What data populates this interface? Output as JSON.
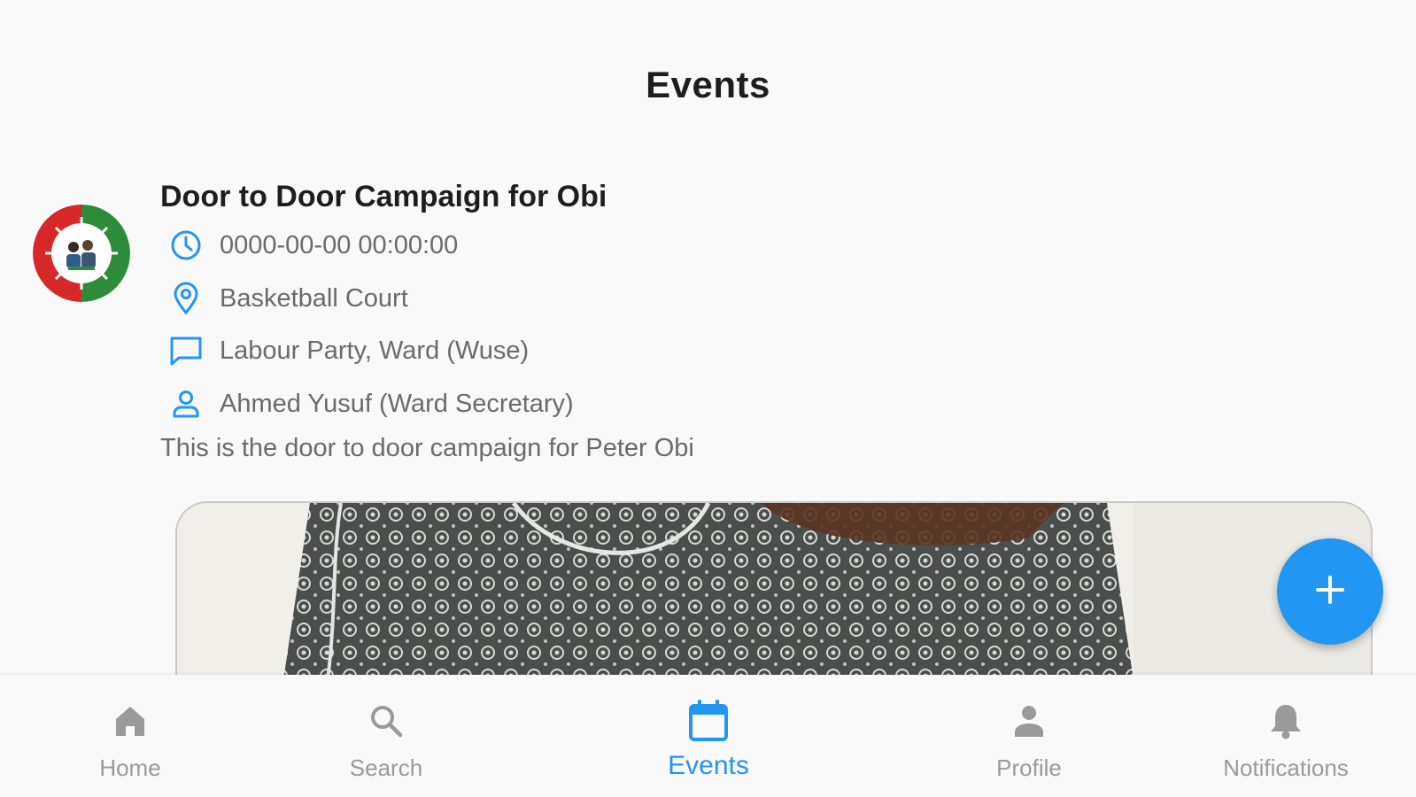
{
  "header": {
    "title": "Events"
  },
  "event": {
    "title": "Door to Door Campaign for Obi",
    "datetime": "0000-00-00 00:00:00",
    "location": "Basketball Court",
    "organization": "Labour Party, Ward (Wuse)",
    "organizer": "Ahmed Yusuf (Ward Secretary)",
    "description": "This is the door to door campaign for Peter Obi",
    "icons": {
      "datetime": "clock-icon",
      "location": "location-pin-icon",
      "organization": "chat-bubble-icon",
      "organizer": "person-icon"
    }
  },
  "fab": {
    "icon": "plus-icon"
  },
  "nav": {
    "items": [
      {
        "label": "Home",
        "icon": "home-icon"
      },
      {
        "label": "Search",
        "icon": "search-icon"
      },
      {
        "label": "Events",
        "icon": "calendar-icon",
        "active": true
      },
      {
        "label": "Profile",
        "icon": "person-icon"
      },
      {
        "label": "Notifications",
        "icon": "bell-icon"
      }
    ]
  },
  "colors": {
    "accent": "#2196f3",
    "text": "#1e1e1e",
    "muted": "#6b6b6b",
    "nav_inactive": "#9a9a9a",
    "background": "#f9f9f9"
  }
}
